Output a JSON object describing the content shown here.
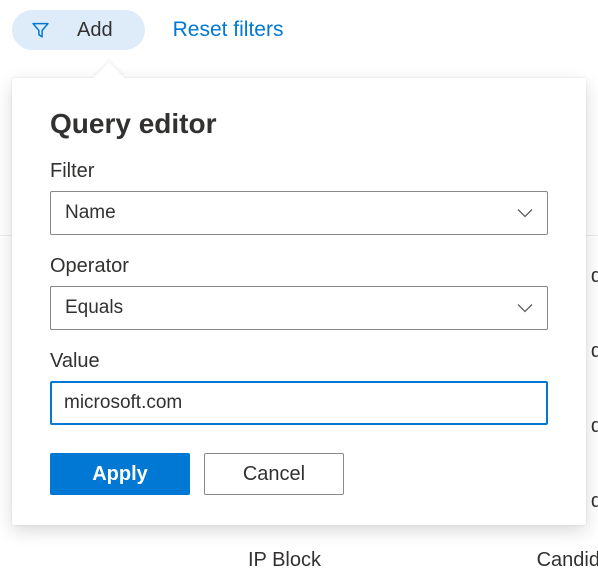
{
  "topBar": {
    "add_label": "Add",
    "reset_label": "Reset filters"
  },
  "queryEditor": {
    "title": "Query editor",
    "filter_label": "Filter",
    "filter_value": "Name",
    "operator_label": "Operator",
    "operator_value": "Equals",
    "value_label": "Value",
    "value_input": "microsoft.com",
    "apply_label": "Apply",
    "cancel_label": "Cancel"
  },
  "background": {
    "ip_block": "IP Block",
    "candid": "Candid",
    "d": "d"
  },
  "colors": {
    "primary": "#0078d4",
    "pillBg": "#deecf9",
    "text": "#323130",
    "border": "#8a8886"
  }
}
